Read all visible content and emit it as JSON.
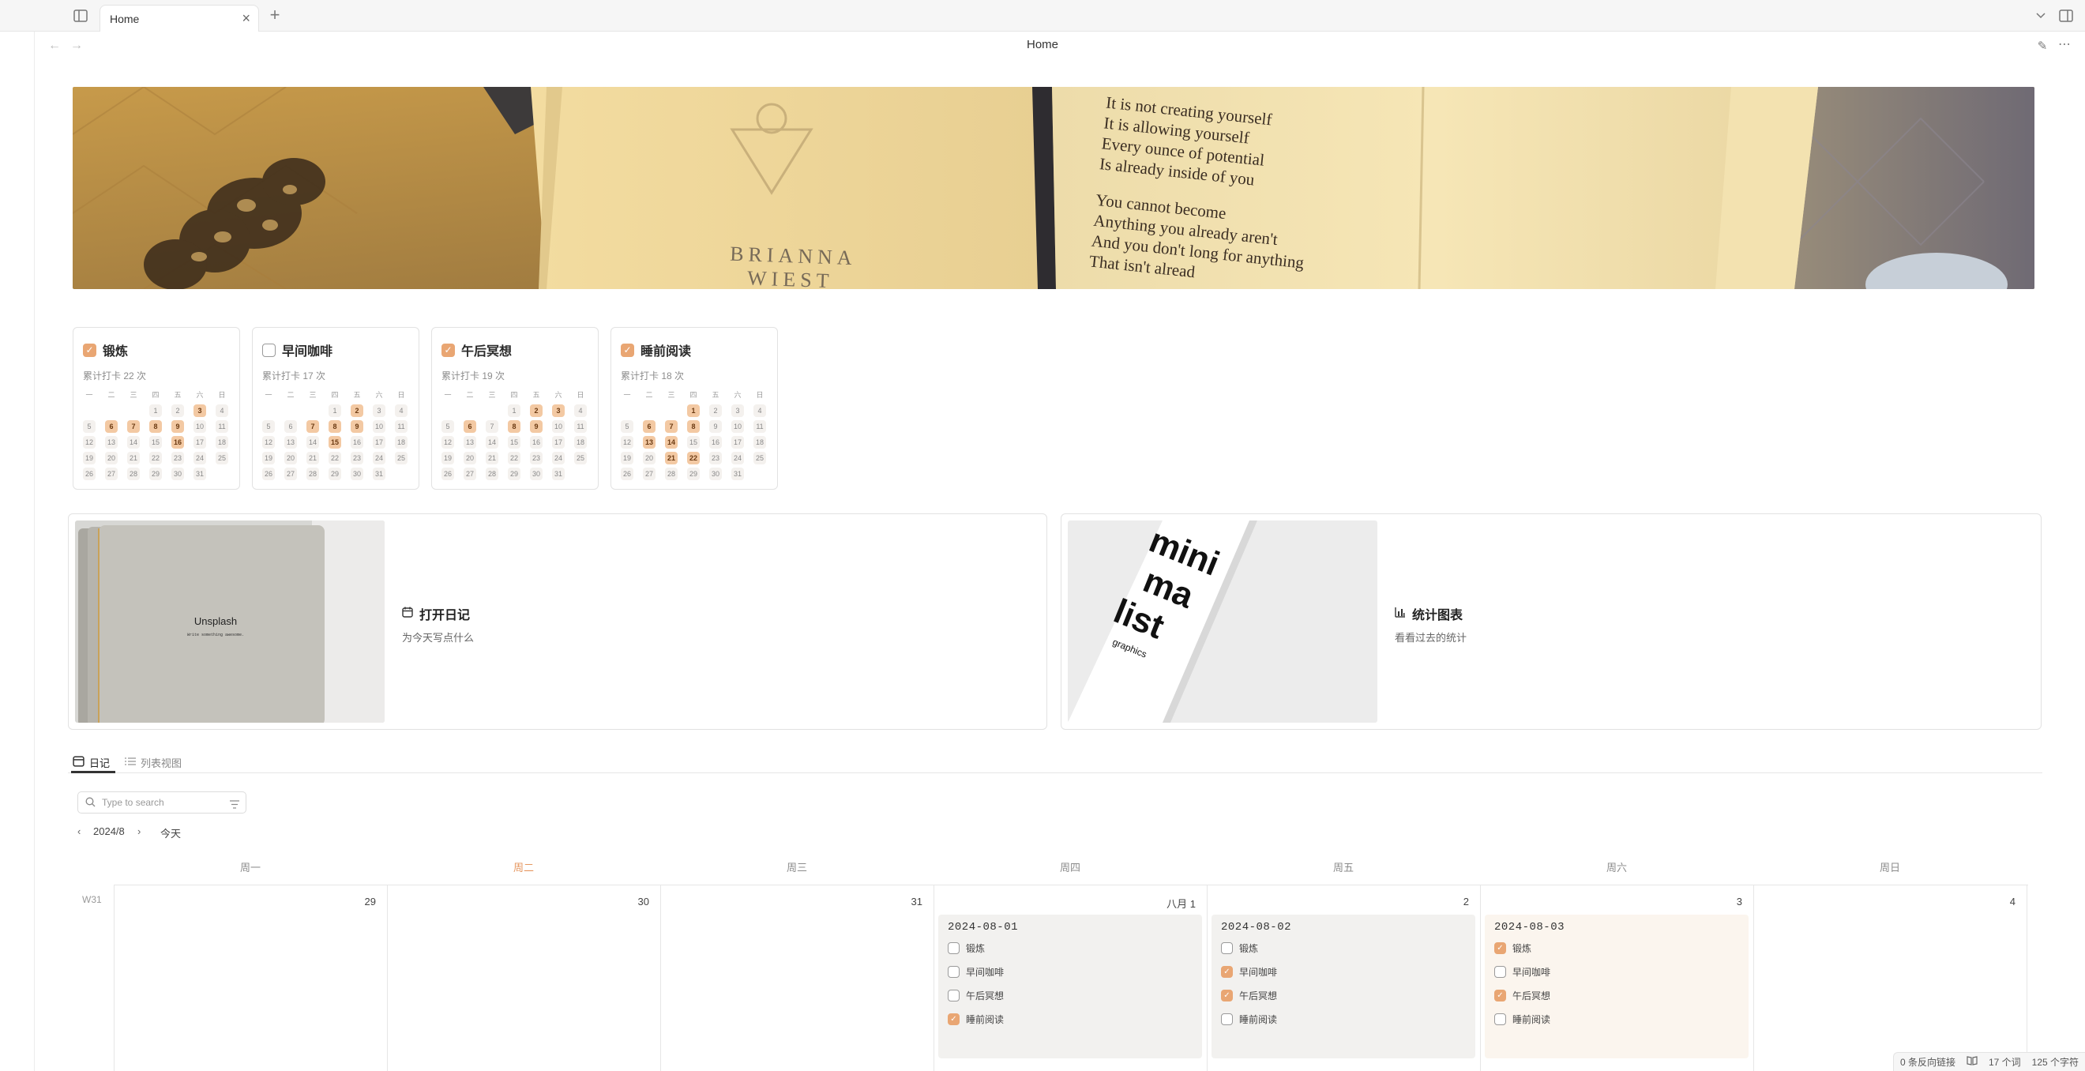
{
  "tabbar": {
    "tab_title": "Home",
    "close_glyph": "×",
    "new_tab_glyph": "+"
  },
  "nav": {
    "title": "Home"
  },
  "habits": [
    {
      "title": "锻炼",
      "checked": true,
      "sub": "累计打卡 22 次",
      "hits": [
        3,
        6,
        7,
        8,
        9,
        16
      ]
    },
    {
      "title": "早间咖啡",
      "checked": false,
      "sub": "累计打卡 17 次",
      "hits": [
        2,
        7,
        8,
        9,
        15
      ]
    },
    {
      "title": "午后冥想",
      "checked": true,
      "sub": "累计打卡 19 次",
      "hits": [
        2,
        3,
        6,
        8,
        9
      ]
    },
    {
      "title": "睡前阅读",
      "checked": true,
      "sub": "累计打卡 18 次",
      "hits": [
        1,
        6,
        7,
        8,
        13,
        14,
        21,
        22
      ]
    }
  ],
  "weekday_short": [
    "一",
    "二",
    "三",
    "四",
    "五",
    "六",
    "日"
  ],
  "link_cards": [
    {
      "title": "打开日记",
      "sub": "为今天写点什么",
      "icon": "calendar-icon",
      "thumb_text": "Unsplash",
      "thumb_sub": "Write something awesome."
    },
    {
      "title": "统计图表",
      "sub": "看看过去的统计",
      "icon": "bar-chart-icon",
      "thumb_words": [
        "mini",
        "ma",
        "list",
        "graphics"
      ]
    }
  ],
  "view_tabs": {
    "journal": "日记",
    "list": "列表视图"
  },
  "search": {
    "placeholder": "Type to search"
  },
  "month_nav": {
    "month": "2024/8",
    "today": "今天"
  },
  "week": {
    "label": "W31",
    "days": [
      "周一",
      "周二",
      "周三",
      "周四",
      "周五",
      "周六",
      "周日"
    ],
    "today_index": 1,
    "nums": [
      "29",
      "30",
      "31",
      "八月 1",
      "2",
      "3",
      "4"
    ]
  },
  "entries": [
    {
      "date": "2024-08-01",
      "items": [
        {
          "label": "锻炼",
          "checked": false
        },
        {
          "label": "早间咖啡",
          "checked": false
        },
        {
          "label": "午后冥想",
          "checked": false
        },
        {
          "label": "睡前阅读",
          "checked": true
        }
      ]
    },
    {
      "date": "2024-08-02",
      "items": [
        {
          "label": "锻炼",
          "checked": false
        },
        {
          "label": "早间咖啡",
          "checked": true
        },
        {
          "label": "午后冥想",
          "checked": true
        },
        {
          "label": "睡前阅读",
          "checked": false
        }
      ]
    },
    {
      "date": "2024-08-03",
      "items": [
        {
          "label": "锻炼",
          "checked": true
        },
        {
          "label": "早间咖啡",
          "checked": false
        },
        {
          "label": "午后冥想",
          "checked": true
        },
        {
          "label": "睡前阅读",
          "checked": false
        }
      ]
    }
  ],
  "banner": {
    "poem_lines": [
      "It is not creating yourself",
      "It is allowing yourself",
      "Every ounce of potential",
      "Is already inside of you",
      "You cannot become",
      "Anything you already aren't",
      "And you don't long for anything",
      "That isn't alread"
    ],
    "author_lines": [
      "BRIANNA",
      "WIEST"
    ]
  },
  "status": {
    "backlinks": "0 条反向链接",
    "words": "17 个词",
    "chars": "125 个字符"
  }
}
